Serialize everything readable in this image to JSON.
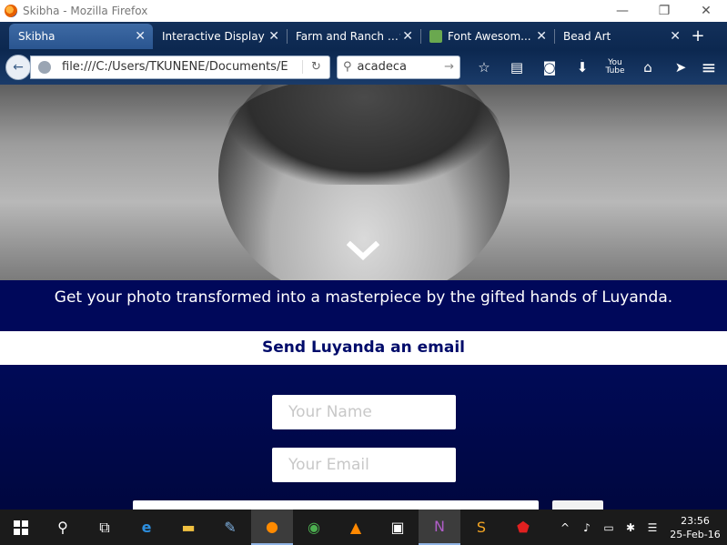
{
  "window": {
    "title": "Skibha - Mozilla Firefox",
    "buttons": {
      "minimize": "—",
      "maximize": "❐",
      "close": "✕"
    }
  },
  "tabs": [
    {
      "label": "Skibha",
      "active": true
    },
    {
      "label": "Interactive Display"
    },
    {
      "label": "Farm and Ranch S..."
    },
    {
      "label": "Font Awesom..."
    },
    {
      "label": "Bead Art"
    }
  ],
  "newtab_label": "+",
  "navbar": {
    "url": "file:///C:/Users/TKUNENE/Documents/E",
    "search_value": "acadeca",
    "youtube_label": "You Tube"
  },
  "page": {
    "caption": "Get your photo transformed into a masterpiece by the gifted hands of Luyanda.",
    "email_heading": "Send Luyanda an email",
    "name_placeholder": "Your Name",
    "email_placeholder": "Your Email"
  },
  "taskbar": {
    "clock_time": "23:56",
    "clock_date": "25-Feb-16"
  },
  "colors": {
    "caption_bg": "#00085a",
    "heading_text": "#000b6a",
    "form_bg": "#000a57"
  }
}
